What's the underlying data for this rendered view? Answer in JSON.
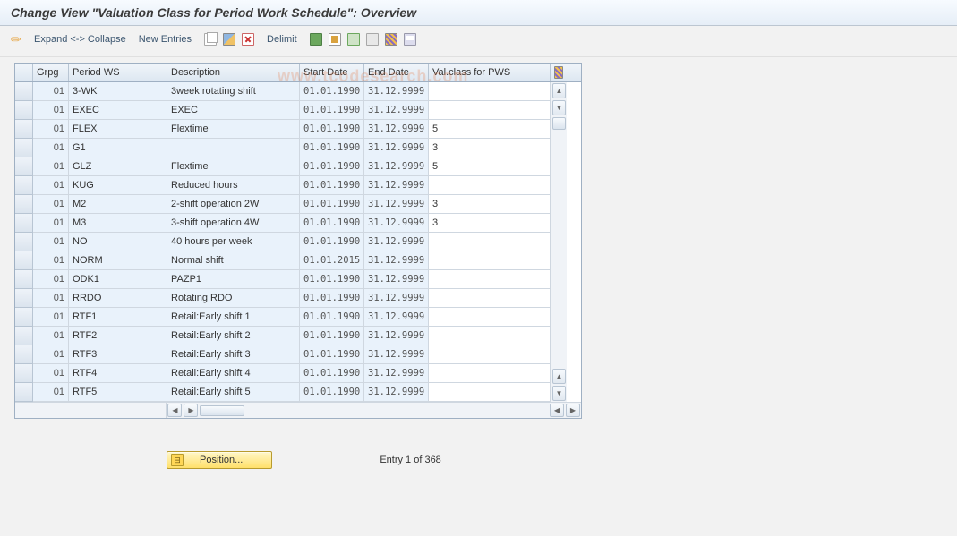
{
  "title": "Change View \"Valuation Class for Period Work Schedule\": Overview",
  "toolbar": {
    "expand_collapse": "Expand <-> Collapse",
    "new_entries": "New Entries",
    "delimit": "Delimit"
  },
  "columns": {
    "grpg": "Grpg",
    "period_ws": "Period WS",
    "description": "Description",
    "start_date": "Start Date",
    "end_date": "End Date",
    "val_class": "Val.class for PWS"
  },
  "rows": [
    {
      "grpg": "01",
      "pws": "3-WK",
      "desc": "3week rotating shift",
      "sd": "01.01.1990",
      "ed": "31.12.9999",
      "vc": ""
    },
    {
      "grpg": "01",
      "pws": "EXEC",
      "desc": "EXEC",
      "sd": "01.01.1990",
      "ed": "31.12.9999",
      "vc": ""
    },
    {
      "grpg": "01",
      "pws": "FLEX",
      "desc": "Flextime",
      "sd": "01.01.1990",
      "ed": "31.12.9999",
      "vc": "5"
    },
    {
      "grpg": "01",
      "pws": "G1",
      "desc": "",
      "sd": "01.01.1990",
      "ed": "31.12.9999",
      "vc": "3"
    },
    {
      "grpg": "01",
      "pws": "GLZ",
      "desc": "Flextime",
      "sd": "01.01.1990",
      "ed": "31.12.9999",
      "vc": "5"
    },
    {
      "grpg": "01",
      "pws": "KUG",
      "desc": "Reduced hours",
      "sd": "01.01.1990",
      "ed": "31.12.9999",
      "vc": ""
    },
    {
      "grpg": "01",
      "pws": "M2",
      "desc": "2-shift operation 2W",
      "sd": "01.01.1990",
      "ed": "31.12.9999",
      "vc": "3"
    },
    {
      "grpg": "01",
      "pws": "M3",
      "desc": "3-shift operation 4W",
      "sd": "01.01.1990",
      "ed": "31.12.9999",
      "vc": "3"
    },
    {
      "grpg": "01",
      "pws": "NO",
      "desc": "40 hours per week",
      "sd": "01.01.1990",
      "ed": "31.12.9999",
      "vc": ""
    },
    {
      "grpg": "01",
      "pws": "NORM",
      "desc": "Normal shift",
      "sd": "01.01.2015",
      "ed": "31.12.9999",
      "vc": ""
    },
    {
      "grpg": "01",
      "pws": "ODK1",
      "desc": "PAZP1",
      "sd": "01.01.1990",
      "ed": "31.12.9999",
      "vc": ""
    },
    {
      "grpg": "01",
      "pws": "RRDO",
      "desc": "Rotating RDO",
      "sd": "01.01.1990",
      "ed": "31.12.9999",
      "vc": ""
    },
    {
      "grpg": "01",
      "pws": "RTF1",
      "desc": "Retail:Early shift 1",
      "sd": "01.01.1990",
      "ed": "31.12.9999",
      "vc": ""
    },
    {
      "grpg": "01",
      "pws": "RTF2",
      "desc": "Retail:Early shift 2",
      "sd": "01.01.1990",
      "ed": "31.12.9999",
      "vc": ""
    },
    {
      "grpg": "01",
      "pws": "RTF3",
      "desc": "Retail:Early shift 3",
      "sd": "01.01.1990",
      "ed": "31.12.9999",
      "vc": ""
    },
    {
      "grpg": "01",
      "pws": "RTF4",
      "desc": "Retail:Early shift 4",
      "sd": "01.01.1990",
      "ed": "31.12.9999",
      "vc": ""
    },
    {
      "grpg": "01",
      "pws": "RTF5",
      "desc": "Retail:Early shift 5",
      "sd": "01.01.1990",
      "ed": "31.12.9999",
      "vc": ""
    }
  ],
  "footer": {
    "position_label": "Position...",
    "entry_text": "Entry 1 of 368"
  },
  "watermark": "www.tcodesearch.com"
}
